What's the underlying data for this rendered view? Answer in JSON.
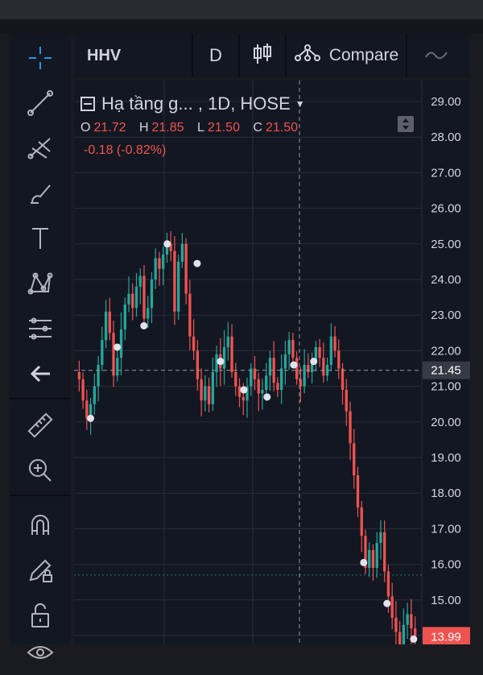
{
  "header": {
    "symbol": "HHV",
    "interval": "D",
    "compare_label": "Compare"
  },
  "legend": {
    "title": "Hạ tầng g... , 1D, HOSE",
    "o_label": "O",
    "o_value": "21.72",
    "h_label": "H",
    "h_value": "21.85",
    "l_label": "L",
    "l_value": "21.50",
    "c_label": "C",
    "c_value": "21.50",
    "change": "-0.18 (-0.82%)"
  },
  "tools": [
    "crosshair-icon",
    "trend-line-icon",
    "pitchfork-icon",
    "brush-icon",
    "text-icon",
    "pattern-icon",
    "fib-icon",
    "back-arrow-icon",
    "ruler-icon",
    "zoom-in-icon",
    "magnet-icon",
    "pencil-lock-icon",
    "lock-icon",
    "eye-icon"
  ],
  "colors": {
    "up": "#26a69a",
    "down": "#ef5350",
    "background": "#131722",
    "grid": "#2a2e39",
    "text": "#d1d4dc"
  },
  "chart_data": {
    "type": "candlestick",
    "y_ticks": [
      "29.00",
      "28.00",
      "27.00",
      "26.00",
      "25.00",
      "24.00",
      "23.00",
      "22.00",
      "21.00",
      "20.00",
      "19.00",
      "18.00",
      "17.00",
      "16.00",
      "15.00",
      "14.00"
    ],
    "ylim": [
      13.5,
      29.6
    ],
    "last_price_label": "21.45",
    "last_price_value": 21.45,
    "current_price_label": "13.99",
    "current_price_value": 13.99,
    "secondary_line_value": 15.7,
    "closes": [
      21.2,
      20.6,
      20.1,
      20.5,
      21.0,
      21.6,
      22.3,
      23.1,
      22.5,
      21.3,
      21.8,
      22.6,
      23.3,
      23.6,
      23.2,
      23.8,
      24.1,
      22.9,
      23.2,
      24.0,
      24.6,
      24.3,
      24.7,
      25.0,
      24.8,
      23.1,
      24.5,
      25.0,
      23.6,
      22.4,
      22.0,
      21.2,
      20.6,
      21.0,
      20.5,
      21.4,
      21.9,
      21.5,
      22.1,
      22.4,
      21.4,
      21.0,
      20.7,
      20.6,
      21.0,
      21.5,
      21.2,
      20.8,
      20.9,
      21.3,
      21.8,
      21.1,
      20.9,
      21.5,
      21.9,
      22.3,
      21.8,
      21.2,
      21.0,
      21.6,
      21.4,
      21.7,
      22.1,
      21.8,
      21.3,
      21.6,
      22.4,
      22.0,
      21.5,
      20.9,
      20.3,
      19.4,
      18.5,
      17.6,
      16.8,
      15.9,
      16.4,
      15.9,
      16.6,
      16.9,
      15.8,
      15.1,
      14.5,
      14.1,
      13.7,
      14.3,
      14.6,
      14.2,
      13.99
    ],
    "markers": [
      {
        "i": 4,
        "y": 20.1
      },
      {
        "i": 12,
        "y": 22.1
      },
      {
        "i": 20,
        "y": 22.7
      },
      {
        "i": 27,
        "y": 25.0
      },
      {
        "i": 36,
        "y": 24.45
      },
      {
        "i": 43,
        "y": 21.7
      },
      {
        "i": 50,
        "y": 20.9
      },
      {
        "i": 57,
        "y": 20.7
      },
      {
        "i": 65,
        "y": 21.6
      },
      {
        "i": 71,
        "y": 21.7
      },
      {
        "i": 86,
        "y": 16.05
      },
      {
        "i": 93,
        "y": 14.9
      },
      {
        "i": 101,
        "y": 13.9
      }
    ],
    "grid": true
  }
}
